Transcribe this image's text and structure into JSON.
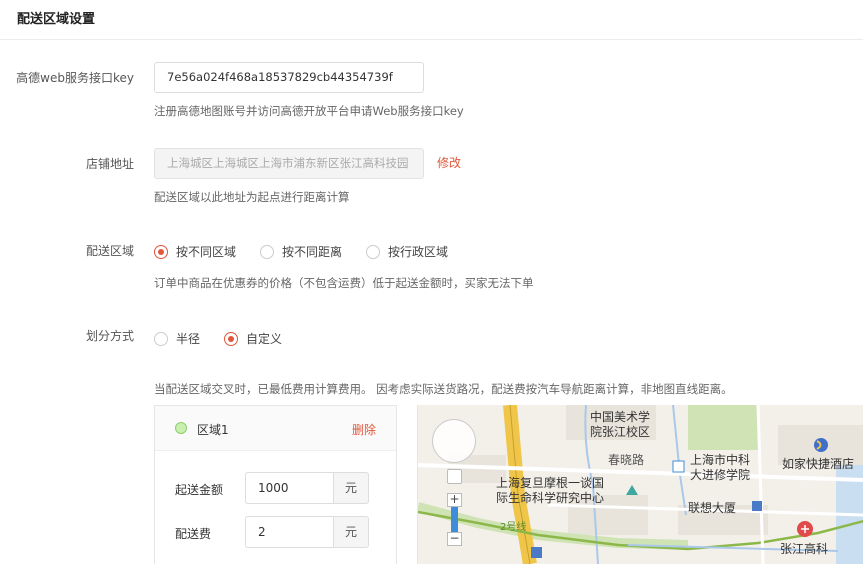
{
  "page": {
    "title": "配送区域设置"
  },
  "api_key": {
    "label": "高德web服务接口key",
    "value": "7e56a024f468a18537829cb44354739f",
    "hint": "注册高德地图账号并访问高德开放平台申请Web服务接口key"
  },
  "store_address": {
    "label": "店铺地址",
    "value": "上海城区上海城区上海市浦东新区张江高科技园",
    "edit_label": "修改",
    "hint": "配送区域以此地址为起点进行距离计算"
  },
  "delivery_area": {
    "label": "配送区域",
    "options": [
      "按不同区域",
      "按不同距离",
      "按行政区域"
    ],
    "selected": 0,
    "hint": "订单中商品在优惠券的价格（不包含运费）低于起送金额时，买家无法下单"
  },
  "division_mode": {
    "label": "划分方式",
    "options": [
      "半径",
      "自定义"
    ],
    "selected": 1,
    "hint": "当配送区域交叉时，已最低费用计算费用。 因考虑实际送货路况，配送费按汽车导航距离计算，非地图直线距离。"
  },
  "zone": {
    "name": "区域1",
    "delete_label": "删除",
    "min_amount_label": "起送金额",
    "min_amount": "1000",
    "fee_label": "配送费",
    "fee": "2",
    "unit": "元"
  },
  "map": {
    "zoom_in": "+",
    "zoom_out": "−",
    "labels": {
      "academy": "中国美术学\n院张江校区",
      "chunxiao_road": "春晓路",
      "research_institute": "上海市中科\n大进修学院",
      "hotel": "如家快捷酒店",
      "fudan": "上海复旦摩根一谈国\n际生命科学研究中心",
      "lenovo": "联想大厦",
      "line2": "2号线",
      "zhangjiang": "张江高科"
    },
    "colors": {
      "accent": "#e0573b",
      "metro": "#8cb84a",
      "road": "#f0c64a"
    }
  }
}
